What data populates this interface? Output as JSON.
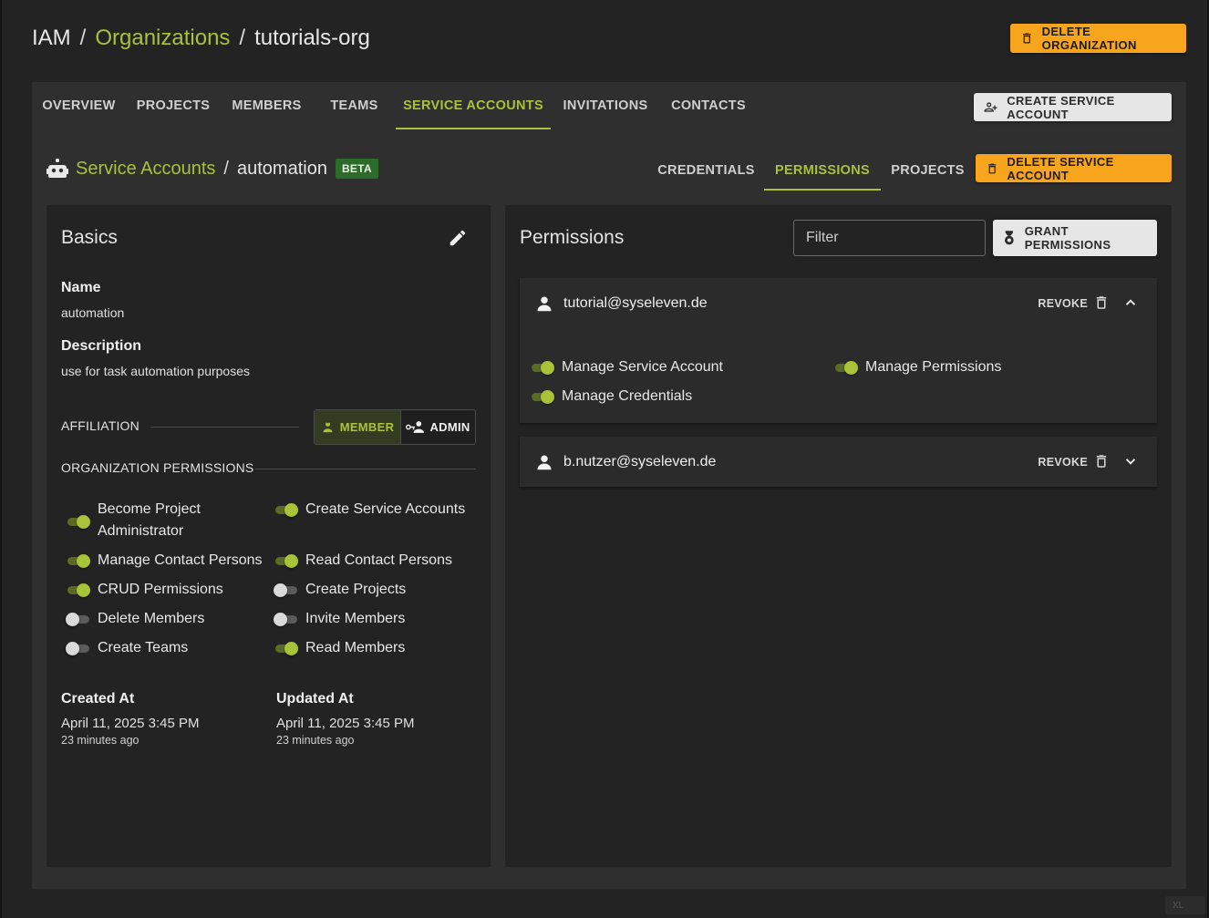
{
  "breadcrumb": {
    "root": "IAM",
    "separator": "/",
    "organizations": "Organizations",
    "current": "tutorials-org"
  },
  "header": {
    "delete_org_label": "DELETE ORGANIZATION"
  },
  "tabs": [
    {
      "label": "OVERVIEW",
      "active": false
    },
    {
      "label": "PROJECTS",
      "active": false
    },
    {
      "label": "MEMBERS",
      "active": false
    },
    {
      "label": "TEAMS",
      "active": false
    },
    {
      "label": "SERVICE ACCOUNTS",
      "active": true
    },
    {
      "label": "INVITATIONS",
      "active": false
    },
    {
      "label": "CONTACTS",
      "active": false
    }
  ],
  "create_sa_label": "CREATE SERVICE ACCOUNT",
  "service_account": {
    "breadcrumb_link": "Service Accounts",
    "separator": "/",
    "name": "automation",
    "badge": "BETA",
    "subtabs": [
      {
        "label": "CREDENTIALS",
        "active": false
      },
      {
        "label": "PERMISSIONS",
        "active": true
      },
      {
        "label": "PROJECTS",
        "active": false
      }
    ],
    "delete_label": "DELETE SERVICE ACCOUNT"
  },
  "basics": {
    "title": "Basics",
    "name_label": "Name",
    "name_value": "automation",
    "description_label": "Description",
    "description_value": "use for task automation purposes",
    "affiliation_label": "AFFILIATION",
    "affiliation_options": {
      "member": "MEMBER",
      "admin": "ADMIN"
    },
    "affiliation_selected": "MEMBER",
    "org_permissions_label": "ORGANIZATION PERMISSIONS",
    "org_permissions": [
      {
        "label": "Become Project Administrator",
        "enabled": true
      },
      {
        "label": "Create Service Accounts",
        "enabled": true
      },
      {
        "label": "Manage Contact Persons",
        "enabled": true
      },
      {
        "label": "Read Contact Persons",
        "enabled": true
      },
      {
        "label": "CRUD Permissions",
        "enabled": true
      },
      {
        "label": "Create Projects",
        "enabled": false
      },
      {
        "label": "Delete Members",
        "enabled": false
      },
      {
        "label": "Invite Members",
        "enabled": false
      },
      {
        "label": "Create Teams",
        "enabled": false
      },
      {
        "label": "Read Members",
        "enabled": true
      }
    ],
    "created_label": "Created At",
    "created_value": "April 11, 2025 3:45 PM",
    "created_relative": "23 minutes ago",
    "updated_label": "Updated At",
    "updated_value": "April 11, 2025 3:45 PM",
    "updated_relative": "23 minutes ago"
  },
  "permissions": {
    "title": "Permissions",
    "filter_placeholder": "Filter",
    "grant_label": "GRANT PERMISSIONS",
    "entries": [
      {
        "email": "tutorial@syseleven.de",
        "revoke_label": "REVOKE",
        "expanded": true,
        "permissions": [
          {
            "label": "Manage Service Account",
            "enabled": true
          },
          {
            "label": "Manage Permissions",
            "enabled": true
          },
          {
            "label": "Manage Credentials",
            "enabled": true
          }
        ]
      },
      {
        "email": "b.nutzer@syseleven.de",
        "revoke_label": "REVOKE",
        "expanded": false
      }
    ]
  },
  "colors": {
    "accent": "#a8c23a",
    "warning": "#f7a51d",
    "background": "#232323",
    "panel": "#2f2f2f"
  },
  "corner_badge": "XL"
}
